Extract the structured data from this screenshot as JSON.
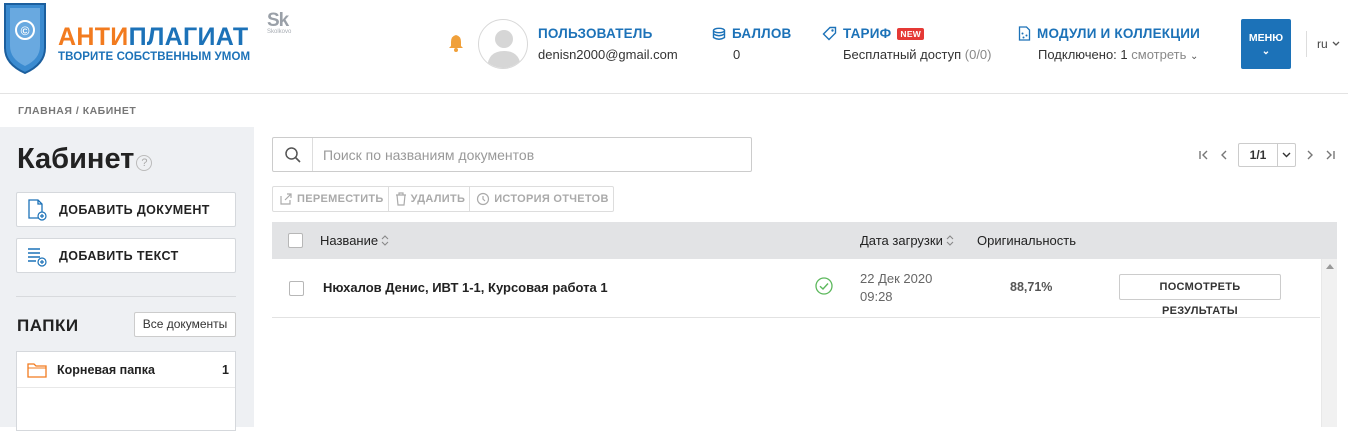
{
  "header": {
    "logo": {
      "word_part1": "АНТИ",
      "word_part2": "ПЛАГИАТ",
      "slogan": "ТВОРИТЕ СОБСТВЕННЫМ УМОМ"
    },
    "partner": {
      "mark": "Sk",
      "caption": "Skolkovo"
    },
    "user": {
      "label": "ПОЛЬЗОВАТЕЛЬ",
      "email": "denisn2000@gmail.com"
    },
    "points": {
      "label": "БАЛЛОВ",
      "value": "0"
    },
    "tariff": {
      "label": "ТАРИФ",
      "badge": "NEW",
      "value": "Бесплатный доступ",
      "count": "(0/0)"
    },
    "modules": {
      "label": "МОДУЛИ И КОЛЛЕКЦИИ",
      "value": "Подключено: 1",
      "link": "смотреть"
    },
    "menu_label": "МЕНЮ",
    "language": "ru"
  },
  "breadcrumb": "ГЛАВНАЯ / КАБИНЕТ",
  "sidebar": {
    "title": "Кабинет",
    "help": "?",
    "add_document": "ДОБАВИТЬ ДОКУМЕНТ",
    "add_text": "ДОБАВИТЬ ТЕКСТ",
    "folders_title": "ПАПКИ",
    "all_documents": "Все документы",
    "folders": [
      {
        "name": "Корневая папка",
        "count": "1"
      }
    ]
  },
  "search": {
    "placeholder": "Поиск по названиям документов"
  },
  "pager": {
    "value": "1/1"
  },
  "toolbar": {
    "move": "ПЕРЕМЕСТИТЬ",
    "delete": "УДАЛИТЬ",
    "history": "ИСТОРИЯ ОТЧЕТОВ"
  },
  "table": {
    "columns": {
      "name": "Название",
      "date": "Дата загрузки",
      "originality": "Оригинальность"
    },
    "rows": [
      {
        "title": "Нюхалов Денис, ИВТ 1-1, Курсовая работа 1",
        "date": "22 Дек 2020",
        "time": "09:28",
        "originality": "88,71%",
        "action": "ПОСМОТРЕТЬ РЕЗУЛЬТАТЫ"
      }
    ]
  },
  "colors": {
    "brand_blue": "#1c72b8",
    "brand_orange": "#f27b1f",
    "ok_green": "#5cb85c",
    "badge_red": "#e53935"
  }
}
